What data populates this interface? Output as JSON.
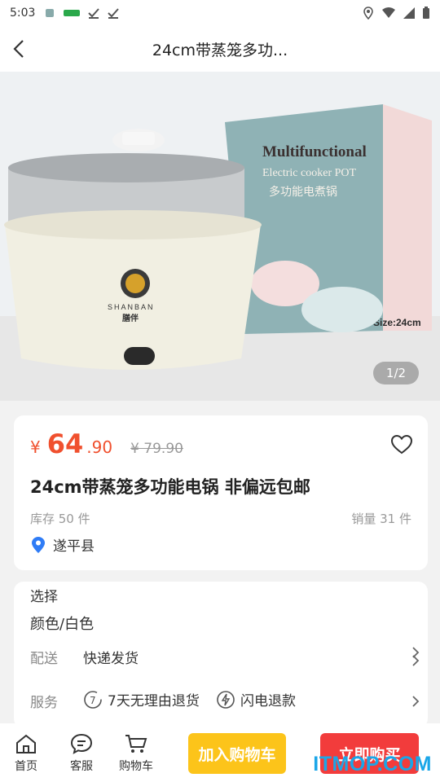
{
  "status_bar": {
    "time": "5:03"
  },
  "header": {
    "title": "24cm带蒸笼多功..."
  },
  "gallery": {
    "counter": "1/2",
    "box_text_1": "Multifunctional",
    "box_text_2": "Electric cooker POT",
    "box_text_3": "多功能电煮锅",
    "box_size": "Size:24cm",
    "brand_en": "SHANBAN",
    "brand_cn": "膳伴"
  },
  "product": {
    "price_symbol": "¥",
    "price_int": "64",
    "price_dec": ".90",
    "original_price": "¥ 79.90",
    "title": "24cm带蒸笼多功能电锅 非偏远包邮",
    "stock": "库存 50 件",
    "sales": "销量 31 件",
    "location": "遂平县"
  },
  "options": {
    "select_label": "选择",
    "select_value": "颜色/白色",
    "delivery_label": "配送",
    "delivery_value": "快递发货",
    "service_label": "服务",
    "service_1": "7天无理由退货",
    "service_2": "闪电退款"
  },
  "bottom_nav": {
    "home": "首页",
    "service": "客服",
    "cart": "购物车",
    "add_to_cart": "加入购物车",
    "buy_now": "立即购买"
  },
  "watermark": "ITMOP.COM",
  "colors": {
    "price": "#f0502e",
    "cart_button": "#fcc41a",
    "buy_button": "#f23c3c",
    "location_icon": "#2f7cf6",
    "watermark": "#1aa6e8"
  }
}
